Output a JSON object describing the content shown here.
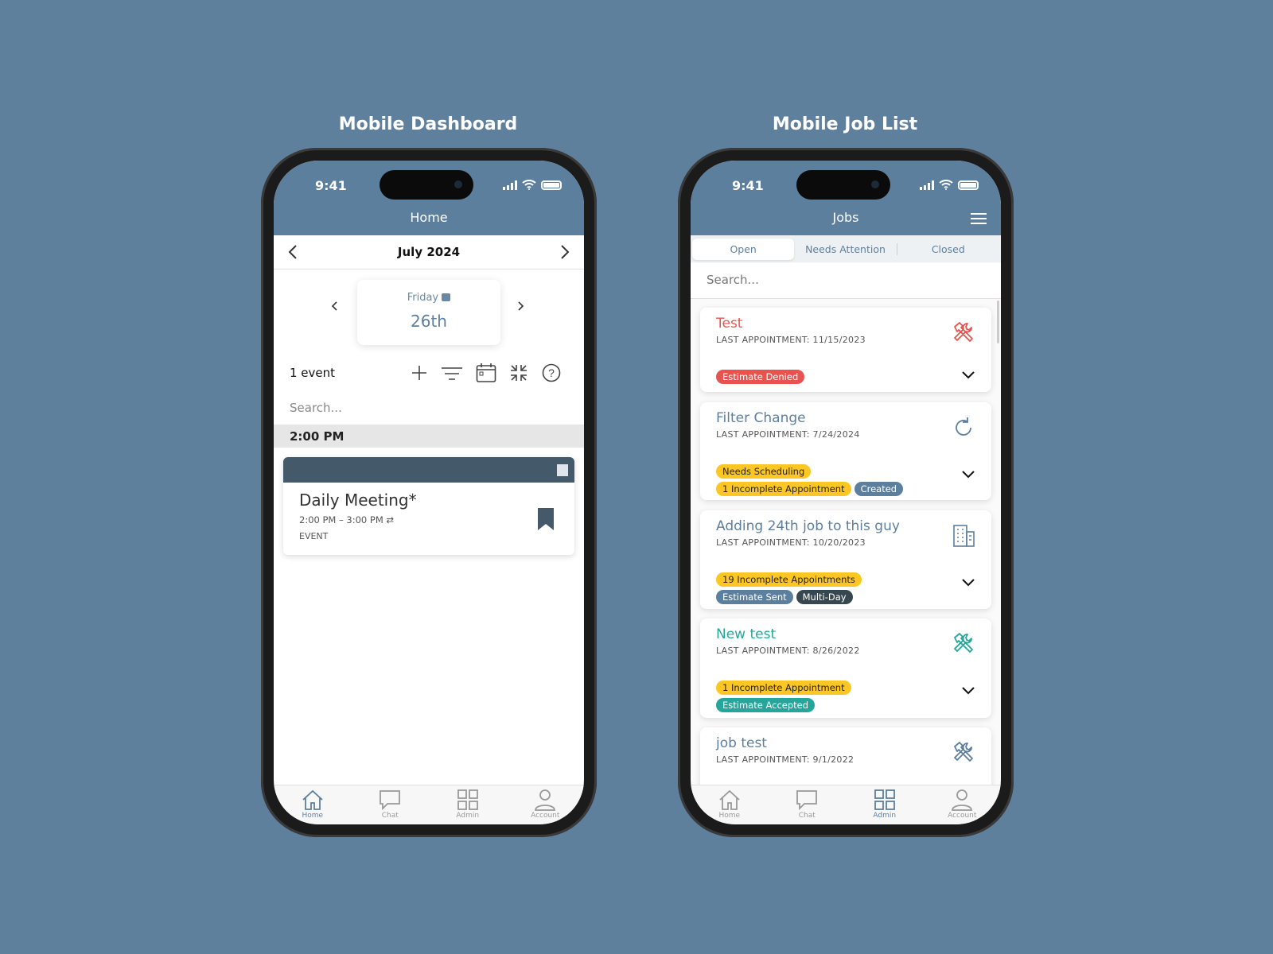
{
  "captions": {
    "left": "Mobile Dashboard",
    "right": "Mobile Job List"
  },
  "status": {
    "time": "9:41"
  },
  "dashboard": {
    "header_title": "Home",
    "month": "July 2024",
    "day_name": "Friday",
    "day_date": "26th",
    "event_count": "1 event",
    "search_placeholder": "Search...",
    "time_group": "2:00 PM",
    "event": {
      "title": "Daily Meeting*",
      "time": "2:00 PM – 3:00 PM",
      "type": "EVENT",
      "header_color": "#44596a"
    }
  },
  "jobs": {
    "header_title": "Jobs",
    "tabs": [
      {
        "label": "Open",
        "active": true
      },
      {
        "label": "Needs Attention"
      },
      {
        "label": "Closed"
      }
    ],
    "search_placeholder": "Search...",
    "list": [
      {
        "title": "Test",
        "title_color": "#e8534f",
        "last": "LAST APPOINTMENT: 11/15/2023",
        "icon": "tools-icon",
        "tags": [
          [
            "Estimate Denied"
          ]
        ]
      },
      {
        "title": "Filter Change",
        "title_color": "#5d7f9e",
        "last": "LAST APPOINTMENT: 7/24/2024",
        "icon": "recurring-icon",
        "tags": [
          [
            "Needs Scheduling"
          ],
          [
            "1 Incomplete Appointment",
            "Created"
          ]
        ]
      },
      {
        "title": "Adding 24th job to this guy",
        "title_color": "#5d7f9e",
        "last": "LAST APPOINTMENT: 10/20/2023",
        "icon": "building-icon",
        "tags": [
          [
            "19 Incomplete Appointments"
          ],
          [
            "Estimate Sent",
            "Multi-Day"
          ]
        ]
      },
      {
        "title": "New test",
        "title_color": "#26a69a",
        "last": "LAST APPOINTMENT: 8/26/2022",
        "icon": "tools-icon",
        "tags": [
          [
            "1 Incomplete Appointment"
          ],
          [
            "Estimate Accepted"
          ]
        ]
      },
      {
        "title": "job test",
        "title_color": "#5d7f9e",
        "last": "LAST APPOINTMENT: 9/1/2022",
        "icon": "tools-icon",
        "tags": []
      }
    ]
  },
  "nav": {
    "items": [
      "Home",
      "Chat",
      "Admin",
      "Account"
    ],
    "left_active": "Home",
    "right_active": "Admin"
  },
  "colors": {
    "brand": "#5d7f9e",
    "yellow": "#fcc624",
    "red": "#e8534f",
    "teal": "#26a69a",
    "dark": "#37474f"
  }
}
